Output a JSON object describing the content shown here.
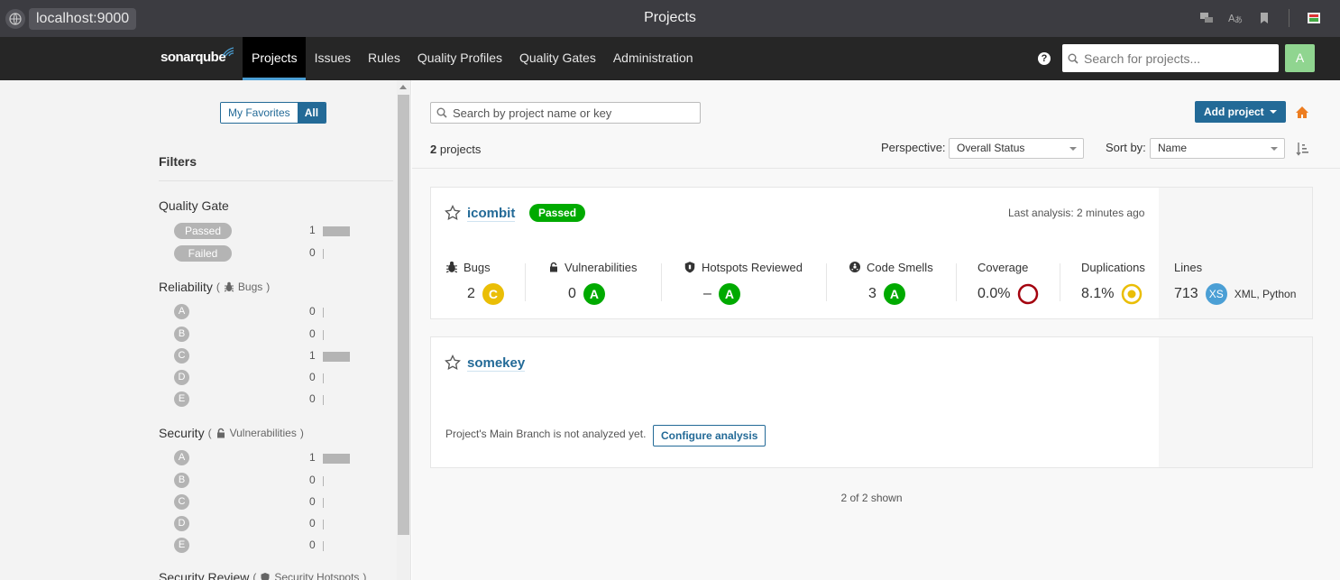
{
  "browser": {
    "url": "localhost:9000",
    "title": "Projects"
  },
  "nav": {
    "logo": "sonarqube",
    "items": [
      "Projects",
      "Issues",
      "Rules",
      "Quality Profiles",
      "Quality Gates",
      "Administration"
    ],
    "help": "?",
    "search_placeholder": "Search for projects...",
    "avatar": "A"
  },
  "sidebar": {
    "my_favorites": "My Favorites",
    "all": "All",
    "filters_title": "Filters",
    "quality_gate": {
      "title": "Quality Gate",
      "rows": [
        {
          "label": "Passed",
          "count": "1"
        },
        {
          "label": "Failed",
          "count": "0"
        }
      ]
    },
    "reliability": {
      "title": "Reliability",
      "sub": "Bugs",
      "rows": [
        {
          "label": "A",
          "count": "0"
        },
        {
          "label": "B",
          "count": "0"
        },
        {
          "label": "C",
          "count": "1"
        },
        {
          "label": "D",
          "count": "0"
        },
        {
          "label": "E",
          "count": "0"
        }
      ]
    },
    "security": {
      "title": "Security",
      "sub": "Vulnerabilities",
      "rows": [
        {
          "label": "A",
          "count": "1"
        },
        {
          "label": "B",
          "count": "0"
        },
        {
          "label": "C",
          "count": "0"
        },
        {
          "label": "D",
          "count": "0"
        },
        {
          "label": "E",
          "count": "0"
        }
      ]
    },
    "security_review": {
      "title": "Security Review",
      "sub": "Security Hotspots"
    }
  },
  "main": {
    "search_placeholder": "Search by project name or key",
    "add_project": "Add project",
    "project_count": "2",
    "projects_word": "projects",
    "perspective_label": "Perspective:",
    "perspective_value": "Overall Status",
    "sortby_label": "Sort by:",
    "sortby_value": "Name",
    "shown": "2 of 2 shown"
  },
  "projects": [
    {
      "name": "icombit",
      "gate": "Passed",
      "last_analysis": "Last analysis: 2 minutes ago",
      "metrics": {
        "bugs": {
          "label": "Bugs",
          "value": "2",
          "rating": "C"
        },
        "vulnerabilities": {
          "label": "Vulnerabilities",
          "value": "0",
          "rating": "A"
        },
        "hotspots": {
          "label": "Hotspots Reviewed",
          "value": "–",
          "rating": "A"
        },
        "smells": {
          "label": "Code Smells",
          "value": "3",
          "rating": "A"
        },
        "coverage": {
          "label": "Coverage",
          "value": "0.0%"
        },
        "duplications": {
          "label": "Duplications",
          "value": "8.1%"
        },
        "lines": {
          "label": "Lines",
          "value": "713",
          "size": "XS",
          "languages": "XML, Python"
        }
      }
    },
    {
      "name": "somekey",
      "not_analyzed": "Project's Main Branch is not analyzed yet.",
      "configure": "Configure analysis"
    }
  ],
  "colors": {
    "rating_a": "#00aa00",
    "rating_c": "#eabe06",
    "coverage_ring": "#a4030f",
    "dup_ring": "#eabe06",
    "brand_blue": "#236a97",
    "home_orange": "#ed7d20"
  }
}
